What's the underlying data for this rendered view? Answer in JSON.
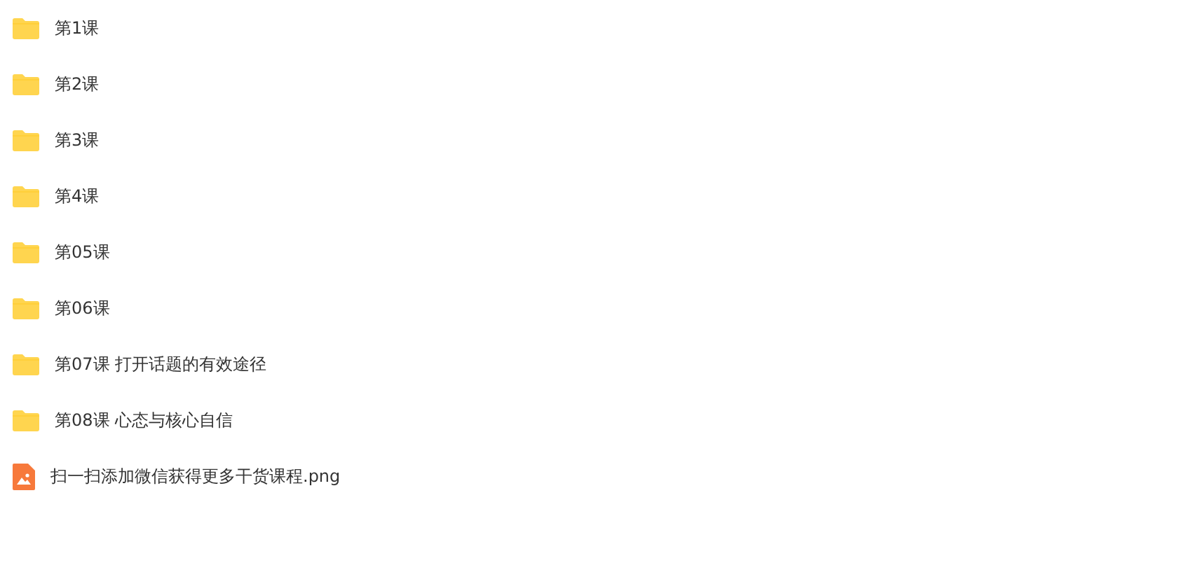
{
  "files": [
    {
      "kind": "folder",
      "name": "第1课"
    },
    {
      "kind": "folder",
      "name": "第2课"
    },
    {
      "kind": "folder",
      "name": "第3课"
    },
    {
      "kind": "folder",
      "name": "第4课"
    },
    {
      "kind": "folder",
      "name": "第05课"
    },
    {
      "kind": "folder",
      "name": "第06课"
    },
    {
      "kind": "folder",
      "name": "第07课 打开话题的有效途径"
    },
    {
      "kind": "folder",
      "name": "第08课 心态与核心自信"
    },
    {
      "kind": "image",
      "name": "扫一扫添加微信获得更多干货课程.png"
    }
  ]
}
